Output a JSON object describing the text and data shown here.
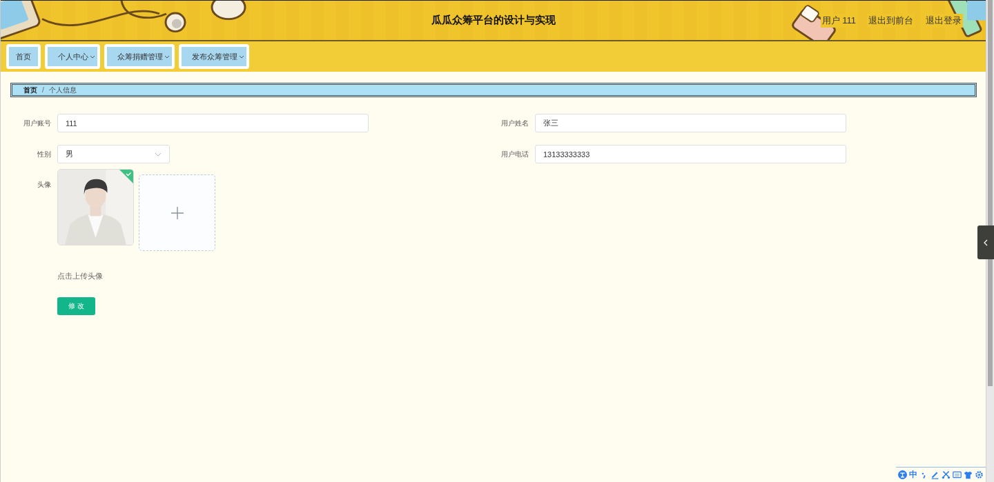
{
  "header": {
    "title": "瓜瓜众筹平台的设计与实现",
    "user": "用户 111",
    "links": [
      "退出到前台",
      "退出登录"
    ]
  },
  "nav": [
    {
      "label": "首页",
      "dropdown": false
    },
    {
      "label": "个人中心",
      "dropdown": true
    },
    {
      "label": "众筹捐赠管理",
      "dropdown": true
    },
    {
      "label": "发布众筹管理",
      "dropdown": true
    }
  ],
  "breadcrumb_separator": "/",
  "breadcrumb": [
    {
      "label": "首页",
      "current": false
    },
    {
      "label": "个人信息",
      "current": true
    }
  ],
  "form": {
    "account": {
      "label": "用户账号",
      "value": "111"
    },
    "name": {
      "label": "用户姓名",
      "value": "张三"
    },
    "gender": {
      "label": "性别",
      "value": "男"
    },
    "phone": {
      "label": "用户电话",
      "value": "13133333333"
    },
    "avatar": {
      "label": "头像",
      "uploaded": true,
      "hint": "点击上传头像"
    },
    "submit": "修 改"
  },
  "ime": {
    "mode": "中"
  }
}
